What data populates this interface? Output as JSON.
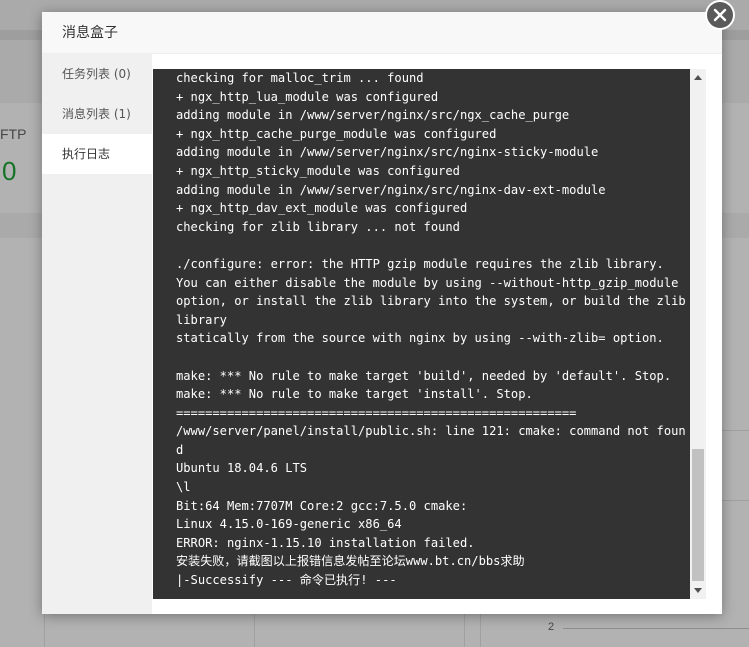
{
  "background": {
    "ftp_label": "FTP",
    "ftp_count": "0",
    "axis_tick": "2"
  },
  "modal": {
    "title": "消息盒子",
    "close_icon": "close-icon",
    "tabs": [
      {
        "label": "任务列表 (0)",
        "active": false
      },
      {
        "label": "消息列表 (1)",
        "active": false
      },
      {
        "label": "执行日志",
        "active": true
      }
    ],
    "log_lines": [
      "checking for malloc_trim ... found",
      "+ ngx_http_lua_module was configured",
      "adding module in /www/server/nginx/src/ngx_cache_purge",
      "+ ngx_http_cache_purge_module was configured",
      "adding module in /www/server/nginx/src/nginx-sticky-module",
      "+ ngx_http_sticky_module was configured",
      "adding module in /www/server/nginx/src/nginx-dav-ext-module",
      "+ ngx_http_dav_ext_module was configured",
      "checking for zlib library ... not found",
      "",
      "./configure: error: the HTTP gzip module requires the zlib library.",
      "You can either disable the module by using --without-http_gzip_module",
      "option, or install the zlib library into the system, or build the zlib",
      "library",
      "statically from the source with nginx by using --with-zlib= option.",
      "",
      "make: *** No rule to make target 'build', needed by 'default'. Stop.",
      "make: *** No rule to make target 'install'. Stop.",
      "=======================================================",
      "/www/server/panel/install/public.sh: line 121: cmake: command not foun",
      "d",
      "Ubuntu 18.04.6 LTS",
      "\\l",
      "Bit:64 Mem:7707M Core:2 gcc:7.5.0 cmake:",
      "Linux 4.15.0-169-generic x86_64",
      "ERROR: nginx-1.15.10 installation failed.",
      "安装失败，请截图以上报错信息发帖至论坛www.bt.cn/bbs求助",
      "|-Successify --- 命令已执行! ---"
    ]
  }
}
